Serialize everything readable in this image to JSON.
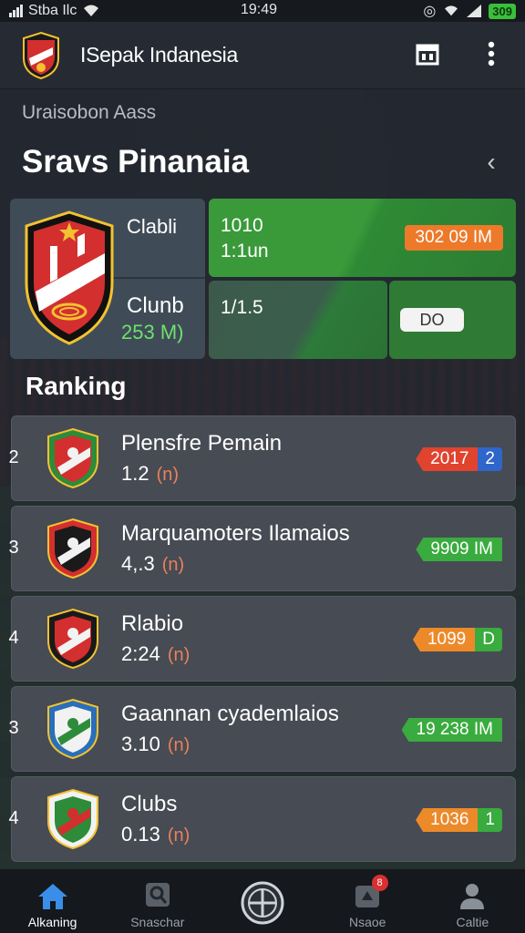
{
  "status_bar": {
    "carrier": "Stba Ilc",
    "time": "19:49",
    "battery": "309"
  },
  "app_bar": {
    "title": "ISepak Indanesia"
  },
  "breadcrumb": "Uraisobon Aass",
  "headline": "Sravs Pinanaia",
  "summary": {
    "club_label": "Clabli",
    "club2_label": "Clunb",
    "club2_value": "253 M)",
    "stat_a1": "1010",
    "stat_a2": "1:1un",
    "stat_b1": "1/1.5",
    "orange_value": "302 09 IM",
    "white_value": "DO"
  },
  "ranking": {
    "title": "Ranking",
    "rows": [
      {
        "pos": "2",
        "name": "Plensfre Pemain",
        "stat": "1.2",
        "indicator": "(n)",
        "tag": "2017",
        "tag_end": "2",
        "tag_color": "#e0432e",
        "end_color": "#2f66c9",
        "crest": "green-red"
      },
      {
        "pos": "3",
        "name": "Marquamoters Ilamaios",
        "stat": "4,.3",
        "indicator": "(n)",
        "tag": "9909 IM",
        "tag_end": "",
        "tag_color": "#3aab3f",
        "end_color": "#3aab3f",
        "crest": "red-black"
      },
      {
        "pos": "4",
        "name": "Rlabio",
        "stat": "2:24",
        "indicator": "(n)",
        "tag": "1099",
        "tag_end": "D",
        "tag_color": "#ec8a2a",
        "end_color": "#3aab3f",
        "crest": "black-red"
      },
      {
        "pos": "3",
        "name": "Gaannan cyademlaios",
        "stat": "3.10",
        "indicator": "(n)",
        "tag": "19 238 IM",
        "tag_end": "",
        "tag_color": "#3aab3f",
        "end_color": "#3aab3f",
        "crest": "blue-white"
      },
      {
        "pos": "4",
        "name": "Clubs",
        "stat": "0.13",
        "indicator": "(n)",
        "tag": "1036",
        "tag_end": "1",
        "tag_color": "#ec8a2a",
        "end_color": "#3aab3f",
        "crest": "white-green"
      }
    ]
  },
  "bottom_nav": {
    "items": [
      {
        "label": "Alkaning",
        "icon": "home-icon"
      },
      {
        "label": "Snaschar",
        "icon": "search-pin-icon"
      },
      {
        "label": "",
        "icon": "ball-icon"
      },
      {
        "label": "Nsaoe",
        "icon": "notification-icon",
        "badge": "8"
      },
      {
        "label": "Caltie",
        "icon": "profile-icon"
      }
    ]
  },
  "colors": {
    "background": "#1f242c",
    "green": "#3aab3f",
    "orange": "#ec7a2a"
  }
}
